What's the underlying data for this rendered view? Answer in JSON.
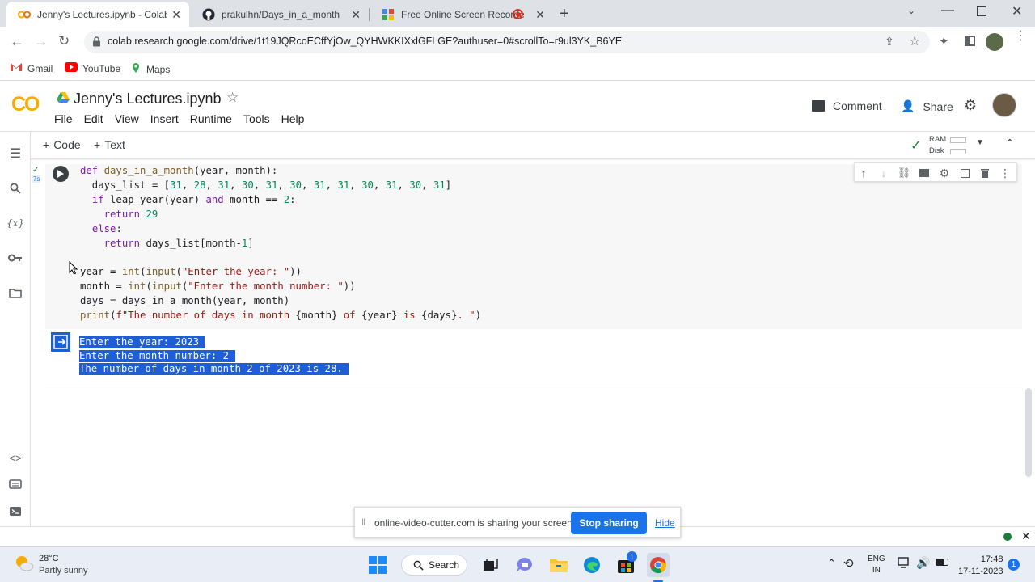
{
  "browser": {
    "tabs": [
      {
        "title": "Jenny's Lectures.ipynb - Colabora",
        "active": true,
        "icon": "colab-icon"
      },
      {
        "title": "prakulhn/Days_in_a_month",
        "active": false,
        "icon": "github-icon"
      },
      {
        "title": "Free Online Screen Recorder",
        "active": false,
        "icon": "recorder-icon"
      }
    ],
    "url": "colab.research.google.com/drive/1t19JQRcoECffYjOw_QYHWKKIXxlGFLGE?authuser=0#scrollTo=r9ul3YK_B6YE",
    "bookmarks": [
      "Gmail",
      "YouTube",
      "Maps"
    ]
  },
  "colab": {
    "logo": "CO",
    "notebook_title": "Jenny's Lectures.ipynb",
    "menu": [
      "File",
      "Edit",
      "View",
      "Insert",
      "Runtime",
      "Tools",
      "Help"
    ],
    "comment_label": "Comment",
    "share_label": "Share",
    "add_code_label": "Code",
    "add_text_label": "Text",
    "ram_label": "RAM",
    "disk_label": "Disk",
    "exec_time": "7s",
    "code_lines": [
      "def days_in_a_month(year, month):",
      "  days_list = [31, 28, 31, 30, 31, 30, 31, 31, 30, 31, 30, 31]",
      "  if leap_year(year) and month == 2:",
      "    return 29",
      "  else:",
      "    return days_list[month-1]",
      "",
      "year = int(input(\"Enter the year: \"))",
      "month = int(input(\"Enter the month number: \"))",
      "days = days_in_a_month(year, month)",
      "print(f\"The number of days in month {month} of {year} is {days}. \")"
    ],
    "output_lines": [
      "Enter the year: 2023 ",
      "Enter the month number: 2 ",
      "The number of days in month 2 of 2023 is 28. "
    ]
  },
  "share_notice": {
    "text": "online-video-cutter.com is sharing your screen.",
    "stop_label": "Stop sharing",
    "hide_label": "Hide"
  },
  "taskbar": {
    "weather_temp": "28°C",
    "weather_desc": "Partly sunny",
    "search_label": "Search",
    "lang_top": "ENG",
    "lang_bottom": "IN",
    "time": "17:48",
    "date": "17-11-2023",
    "notification_count": "1",
    "store_badge": "1"
  },
  "colors": {
    "accent": "#1a73e8",
    "selection": "#1e5fd6",
    "colab_orange": "#f9ab00"
  }
}
